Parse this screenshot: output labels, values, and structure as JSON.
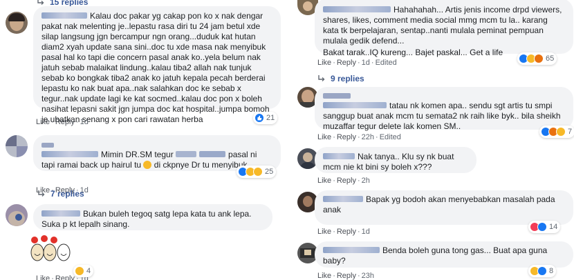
{
  "left": {
    "top_replies": "15 replies",
    "comments": [
      {
        "text": "Kalau doc pakar yg cakap pon ko x nak dengar pakat nak melenting je..lepastu rasa diri tu 24 jam betul xde silap langsung jgn bercampur ngn orang...duduk kat hutan diam2 xyah update sana sini..doc tu xde masa nak menyibuk pasal hal ko tapi die concern pasal anak ko..yela belum nak jatuh sebab malaikat lindung..kalau tiba2 allah nak tunjuk sebab ko bongkak tiba2 anak ko jatuh kepala pecah berderai lepastu ko nak buat apa..nak salahkan doc ke sebab x tegur..nak update lagi ke kat socmed..kalau doc pon x boleh nasihat lepasni sakit jgn jumpa doc kat hospital..jumpa bomoh je ubatkan senang x pon cari rawatan herba",
        "like": "Like",
        "reply": "Reply",
        "time": "1d",
        "react_count": "21"
      },
      {
        "text_a": "Mimin DR.SM tegur",
        "text_b": "pasal ni tapi ramai back up hairul tu",
        "text_c": "di ckpnye Dr tu menyibuk",
        "like": "Like",
        "reply": "Reply",
        "time": "1d",
        "react_count": "25"
      },
      {
        "replies": "7 replies"
      },
      {
        "text": "Bukan buleh tegoq satg lepa kata tu ank lepa. Suka p kt lepalh sinang.",
        "like": "Like",
        "reply": "Reply",
        "time": "1d",
        "react_count": "4"
      }
    ]
  },
  "right": {
    "comments": [
      {
        "text_a": "Hahahahah... Artis jenis income drpd viewers, shares, likes, comment media social mmg mcm tu la.. karang kata tk berpelajaran, sentap..nanti mulala peminat pempuan mulala gedik defend...",
        "text_b": "Bakat tarak..IQ kureng... Bajet paskal... Get a life",
        "like": "Like",
        "reply": "Reply",
        "time": "1d",
        "edited": "Edited",
        "react_count": "65"
      },
      {
        "replies": "9 replies"
      },
      {
        "text": "tatau nk komen apa.. sendu sgt artis tu smpi sanggup buat anak mcm tu semata2 nk raih like byk.. bila sheikh muzaffar tegur delete lak komen SM..",
        "like": "Like",
        "reply": "Reply",
        "time": "22h",
        "edited": "Edited",
        "react_count": "7"
      },
      {
        "text": "Nak tanya.. Klu sy nk buat mcm nie kt bini sy boleh x???",
        "like": "Like",
        "reply": "Reply",
        "time": "2h"
      },
      {
        "text": "Bapak yg bodoh akan menyebabkan masalah pada anak",
        "like": "Like",
        "reply": "Reply",
        "time": "1d",
        "react_count": "14"
      },
      {
        "text": "Benda boleh guna tong gas... Buat apa guna baby?",
        "like": "Like",
        "reply": "Reply",
        "time": "23h",
        "react_count": "8"
      }
    ]
  },
  "colors": {
    "link": "#385898",
    "bubble": "#f2f3f5",
    "meta": "#606770",
    "like_blue": "#1877f2",
    "haha_yellow": "#f7b928"
  },
  "icons": [
    "reply-arrow-icon",
    "like-reaction-icon",
    "haha-reaction-icon",
    "wow-reaction-icon",
    "angry-reaction-icon",
    "love-reaction-icon",
    "laughing-sticker"
  ]
}
